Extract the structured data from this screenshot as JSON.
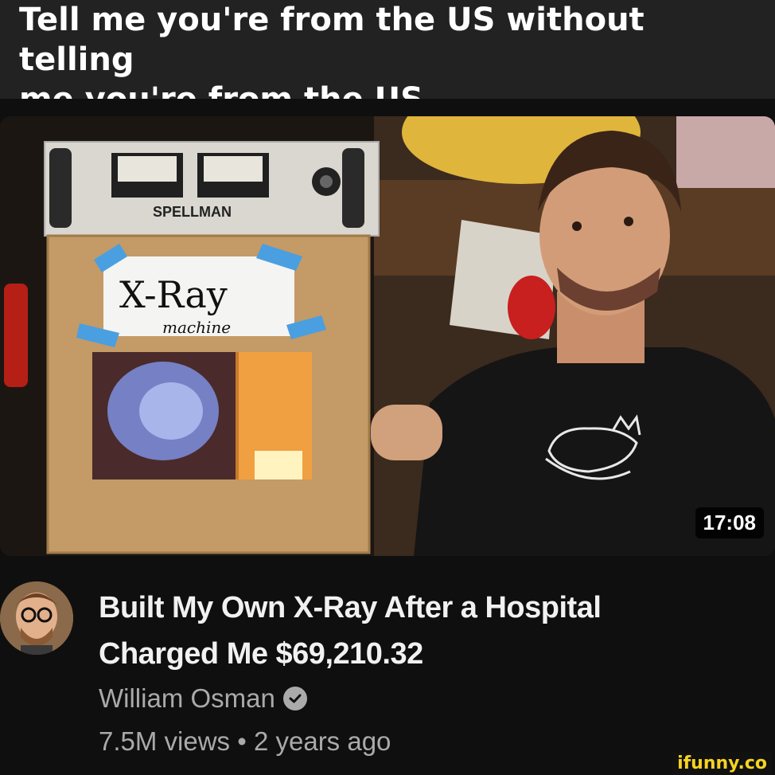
{
  "caption": {
    "line1": "Tell me you're from the US without telling",
    "line2": "me you're from the US"
  },
  "thumbnail": {
    "duration": "17:08",
    "sign_text": "X-Ray",
    "sign_subtext": "machine",
    "device_label": "SPELLMAN"
  },
  "video": {
    "title_line1": "Built My Own X-Ray After a Hospital",
    "title_line2": "Charged Me $69,210.32",
    "channel": "William Osman",
    "views": "7.5M views",
    "separator": "•",
    "age": "2 years ago"
  },
  "icons": {
    "verified": "verified-check-icon"
  },
  "watermark": "ifunny.co",
  "colors": {
    "background": "#0f0f0f",
    "caption_bar": "#222222",
    "secondary_text": "#aaaaaa",
    "watermark": "#f6d31f"
  }
}
